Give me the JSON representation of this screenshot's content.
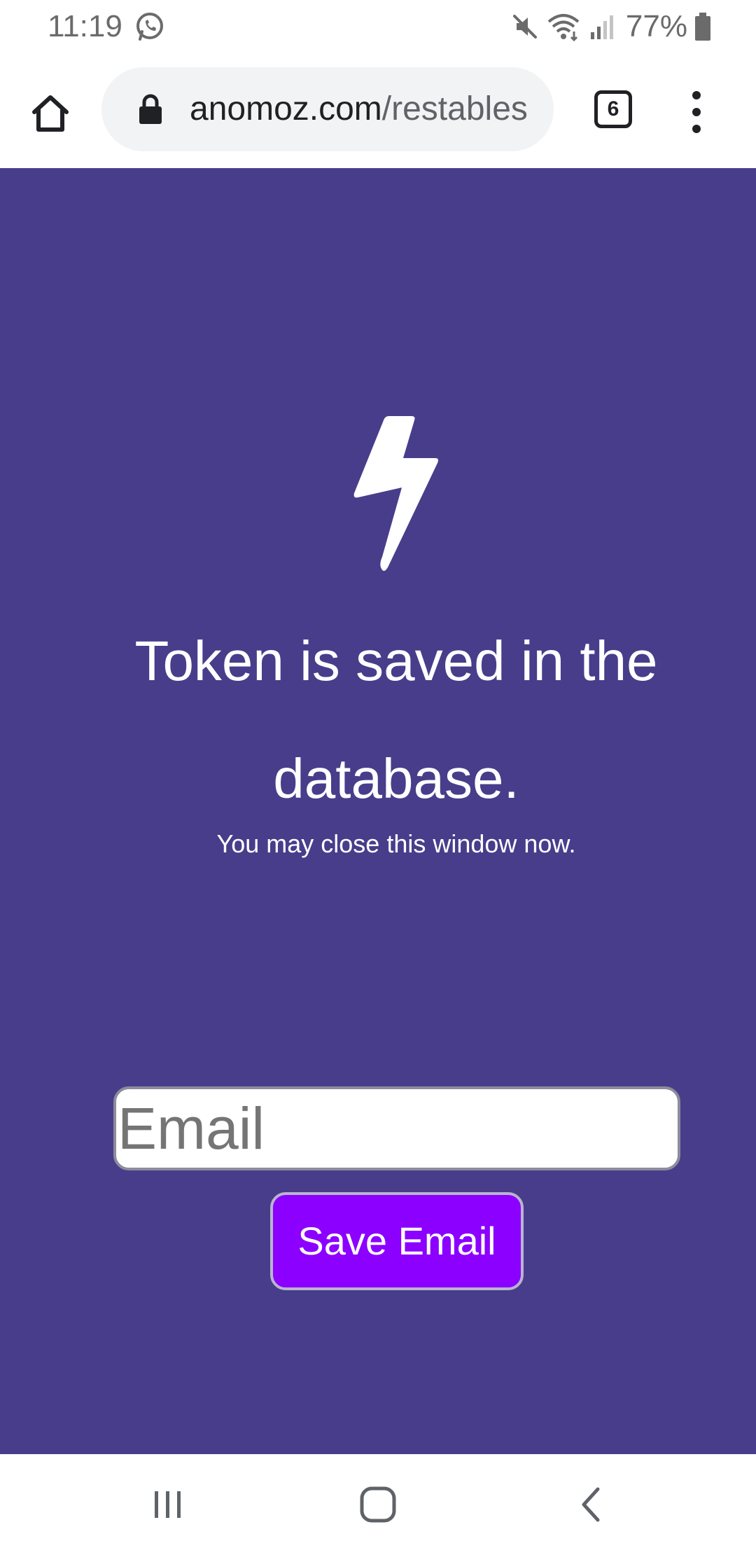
{
  "status_bar": {
    "time": "11:19",
    "battery_percent": "77%",
    "icons": [
      "whatsapp-icon",
      "mute-icon",
      "wifi-icon",
      "signal-icon",
      "battery-icon"
    ]
  },
  "browser": {
    "url_domain": "anomoz.com",
    "url_path": "/restables",
    "tab_count": "6",
    "icons": [
      "home-icon",
      "lock-icon",
      "tabs-icon",
      "more-vert-icon"
    ]
  },
  "page": {
    "background_color": "#483d8b",
    "icon": "lightning-bolt-icon",
    "headline": "Token is saved in the database.",
    "subtext": "You may close this window now.",
    "email_placeholder": "Email",
    "email_value": "",
    "save_button_label": "Save Email",
    "button_color": "#8b00ff"
  },
  "nav_bar": {
    "icons": [
      "recents-icon",
      "home-icon",
      "back-icon"
    ]
  }
}
